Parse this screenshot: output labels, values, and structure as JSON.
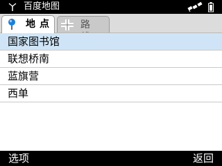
{
  "status_bar": {
    "title": "百度地图",
    "signal_icon": "antenna-icon",
    "gps_icon": "satellite-icon",
    "battery_icon": "battery-icon"
  },
  "tabs": [
    {
      "label": "地点",
      "icon": "map-pin-icon",
      "active": true
    },
    {
      "label": "路线",
      "icon": "route-icon",
      "active": false
    }
  ],
  "list": {
    "items": [
      "国家图书馆",
      "联想桥南",
      "蓝旗营",
      "西单"
    ],
    "selected_index": 0
  },
  "softkeys": {
    "left": "选项",
    "right": "返回"
  },
  "colors": {
    "selection": "#cfe5f7",
    "pin": "#1e7fd6"
  }
}
